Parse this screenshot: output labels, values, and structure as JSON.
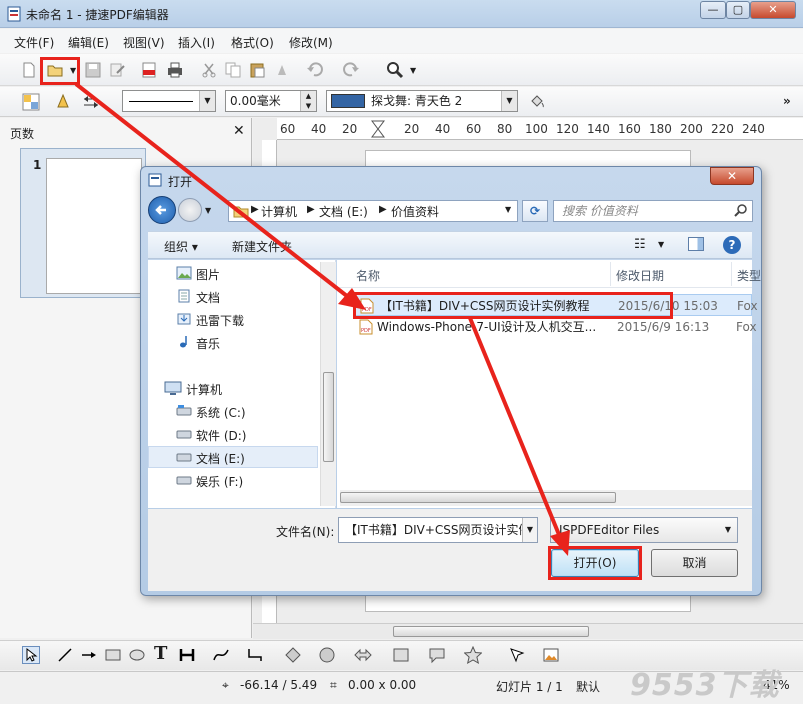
{
  "window": {
    "title": "未命名 1 - 捷速PDF编辑器",
    "min": "—",
    "max": "▢",
    "close": "✕"
  },
  "menu": [
    "文件(F)",
    "编辑(E)",
    "视图(V)",
    "插入(I)",
    "格式(O)",
    "修改(M)"
  ],
  "toolbar2": {
    "line_width": "0.00毫米",
    "color_name": "探戈舞: 青天色 2",
    "color_hex": "#3465a4"
  },
  "pages_panel": {
    "title": "页数",
    "close": "✕",
    "thumb_number": "1"
  },
  "ruler_ticks": [
    "60",
    "40",
    "20",
    "20",
    "40",
    "60",
    "80",
    "100",
    "120",
    "140",
    "160",
    "180",
    "200",
    "220",
    "240"
  ],
  "dialog": {
    "title": "打开",
    "breadcrumb": [
      "计算机",
      "文档 (E:)",
      "价值资料"
    ],
    "search_placeholder": "搜索 价值资料",
    "organize": "组织 ▾",
    "new_folder": "新建文件夹",
    "nav": {
      "libraries": [
        "图片",
        "文档",
        "迅雷下载",
        "音乐"
      ],
      "computer": "计算机",
      "drives": [
        "系统 (C:)",
        "软件 (D:)",
        "文档 (E:)",
        "娱乐 (F:)"
      ]
    },
    "columns": {
      "name": "名称",
      "date": "修改日期",
      "type": "类型"
    },
    "files": [
      {
        "name": "【IT书籍】DIV+CSS网页设计实例教程",
        "date": "2015/6/10 15:03",
        "type": "Fox"
      },
      {
        "name": "Windows-Phone-7-UI设计及人机交互...",
        "date": "2015/6/9 16:13",
        "type": "Fox"
      }
    ],
    "filename_label": "文件名(N):",
    "filename_value": "【IT书籍】DIV+CSS网页设计实例",
    "filetype": "JSPDFEditor Files",
    "open": "打开(O)",
    "cancel": "取消"
  },
  "status": {
    "coords": "-66.14 / 5.49",
    "size": "0.00 x 0.00",
    "slide": "幻灯片 1 / 1",
    "mode": "默认",
    "zoom": "41%"
  },
  "watermark": "9553下载",
  "accent": "#e8231c"
}
